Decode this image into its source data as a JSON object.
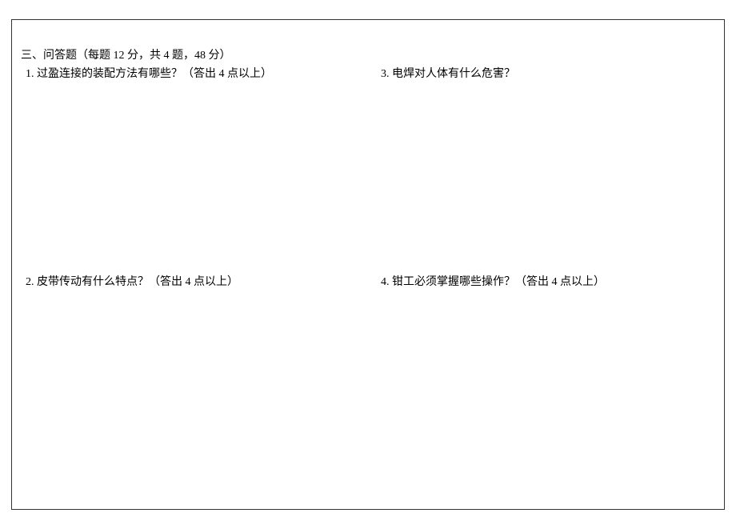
{
  "section": {
    "header": "三、问答题（每题 12 分，共 4 题，48 分）"
  },
  "questions": {
    "q1": "1. 过盈连接的装配方法有哪些？（答出 4 点以上）",
    "q2": "2. 皮带传动有什么特点？（答出 4 点以上）",
    "q3": "3. 电焊对人体有什么危害？",
    "q4": "4. 钳工必须掌握哪些操作？（答出 4 点以上）"
  }
}
